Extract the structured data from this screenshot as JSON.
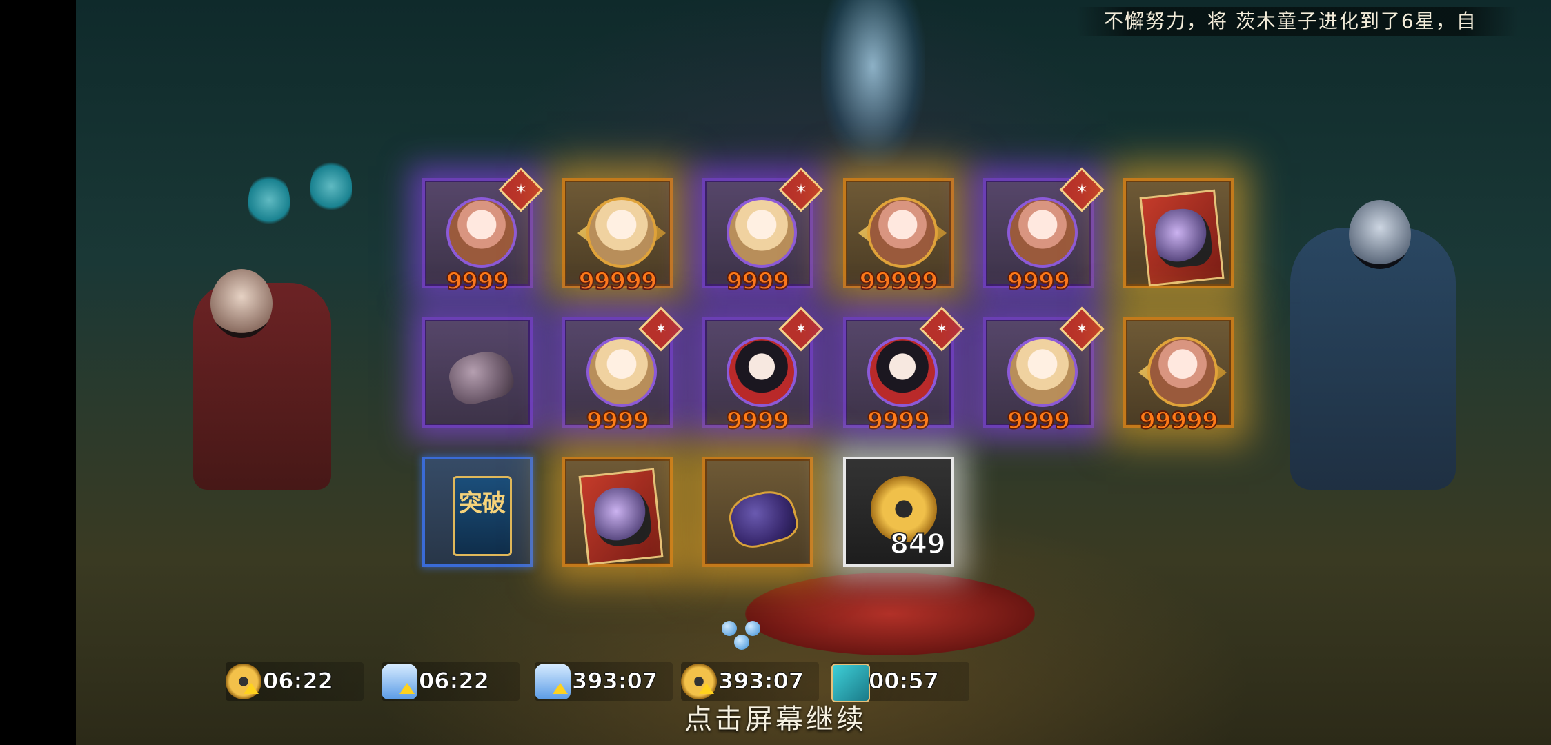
{
  "ticker": {
    "text": "不懈努力，将 茨木童子进化到了6星，自"
  },
  "rewards": [
    {
      "type": "portrait",
      "style": "pink",
      "rarity": "purple",
      "badge": true,
      "qty": "9999"
    },
    {
      "type": "portrait",
      "style": "blonde",
      "rarity": "gold",
      "badge": false,
      "frame": "diamond",
      "qty": "99999"
    },
    {
      "type": "portrait",
      "style": "blonde",
      "rarity": "purple",
      "badge": true,
      "qty": "9999"
    },
    {
      "type": "portrait",
      "style": "pink",
      "rarity": "gold",
      "badge": false,
      "frame": "diamond",
      "qty": "99999"
    },
    {
      "type": "portrait",
      "style": "pink",
      "rarity": "purple",
      "badge": true,
      "qty": "9999"
    },
    {
      "type": "card",
      "rarity": "gold",
      "qty": ""
    },
    {
      "type": "stone",
      "rarity": "purple",
      "qty": ""
    },
    {
      "type": "portrait",
      "style": "blonde",
      "rarity": "purple",
      "badge": true,
      "qty": "9999"
    },
    {
      "type": "portrait",
      "style": "dark",
      "rarity": "purple",
      "badge": true,
      "qty": "9999"
    },
    {
      "type": "portrait",
      "style": "dark",
      "rarity": "purple",
      "badge": true,
      "qty": "9999"
    },
    {
      "type": "portrait",
      "style": "blonde",
      "rarity": "purple",
      "badge": true,
      "qty": "9999"
    },
    {
      "type": "portrait",
      "style": "pink",
      "rarity": "gold",
      "badge": false,
      "frame": "diamond",
      "qty": "99999"
    },
    {
      "type": "scroll",
      "rarity": "blue",
      "label": "突破",
      "qty": ""
    },
    {
      "type": "card",
      "rarity": "gold",
      "qty": ""
    },
    {
      "type": "stone-dark",
      "rarity": "gold",
      "qty": ""
    },
    {
      "type": "coin",
      "rarity": "white",
      "qty": "849"
    }
  ],
  "timers": [
    {
      "icon": "coin-boost-icon",
      "text": "06:22"
    },
    {
      "icon": "jar-boost-icon",
      "text": "06:22"
    },
    {
      "icon": "jar-boost-icon",
      "text": "393:07"
    },
    {
      "icon": "coin-boost-icon",
      "text": "393:07"
    },
    {
      "icon": "ticket-icon",
      "text": "00:57"
    }
  ],
  "prompt": {
    "continue": "点击屏幕继续"
  },
  "colors": {
    "purple_glow": "#9646ff",
    "gold_glow": "#ffb428",
    "qty_orange": "#ff7a17"
  }
}
